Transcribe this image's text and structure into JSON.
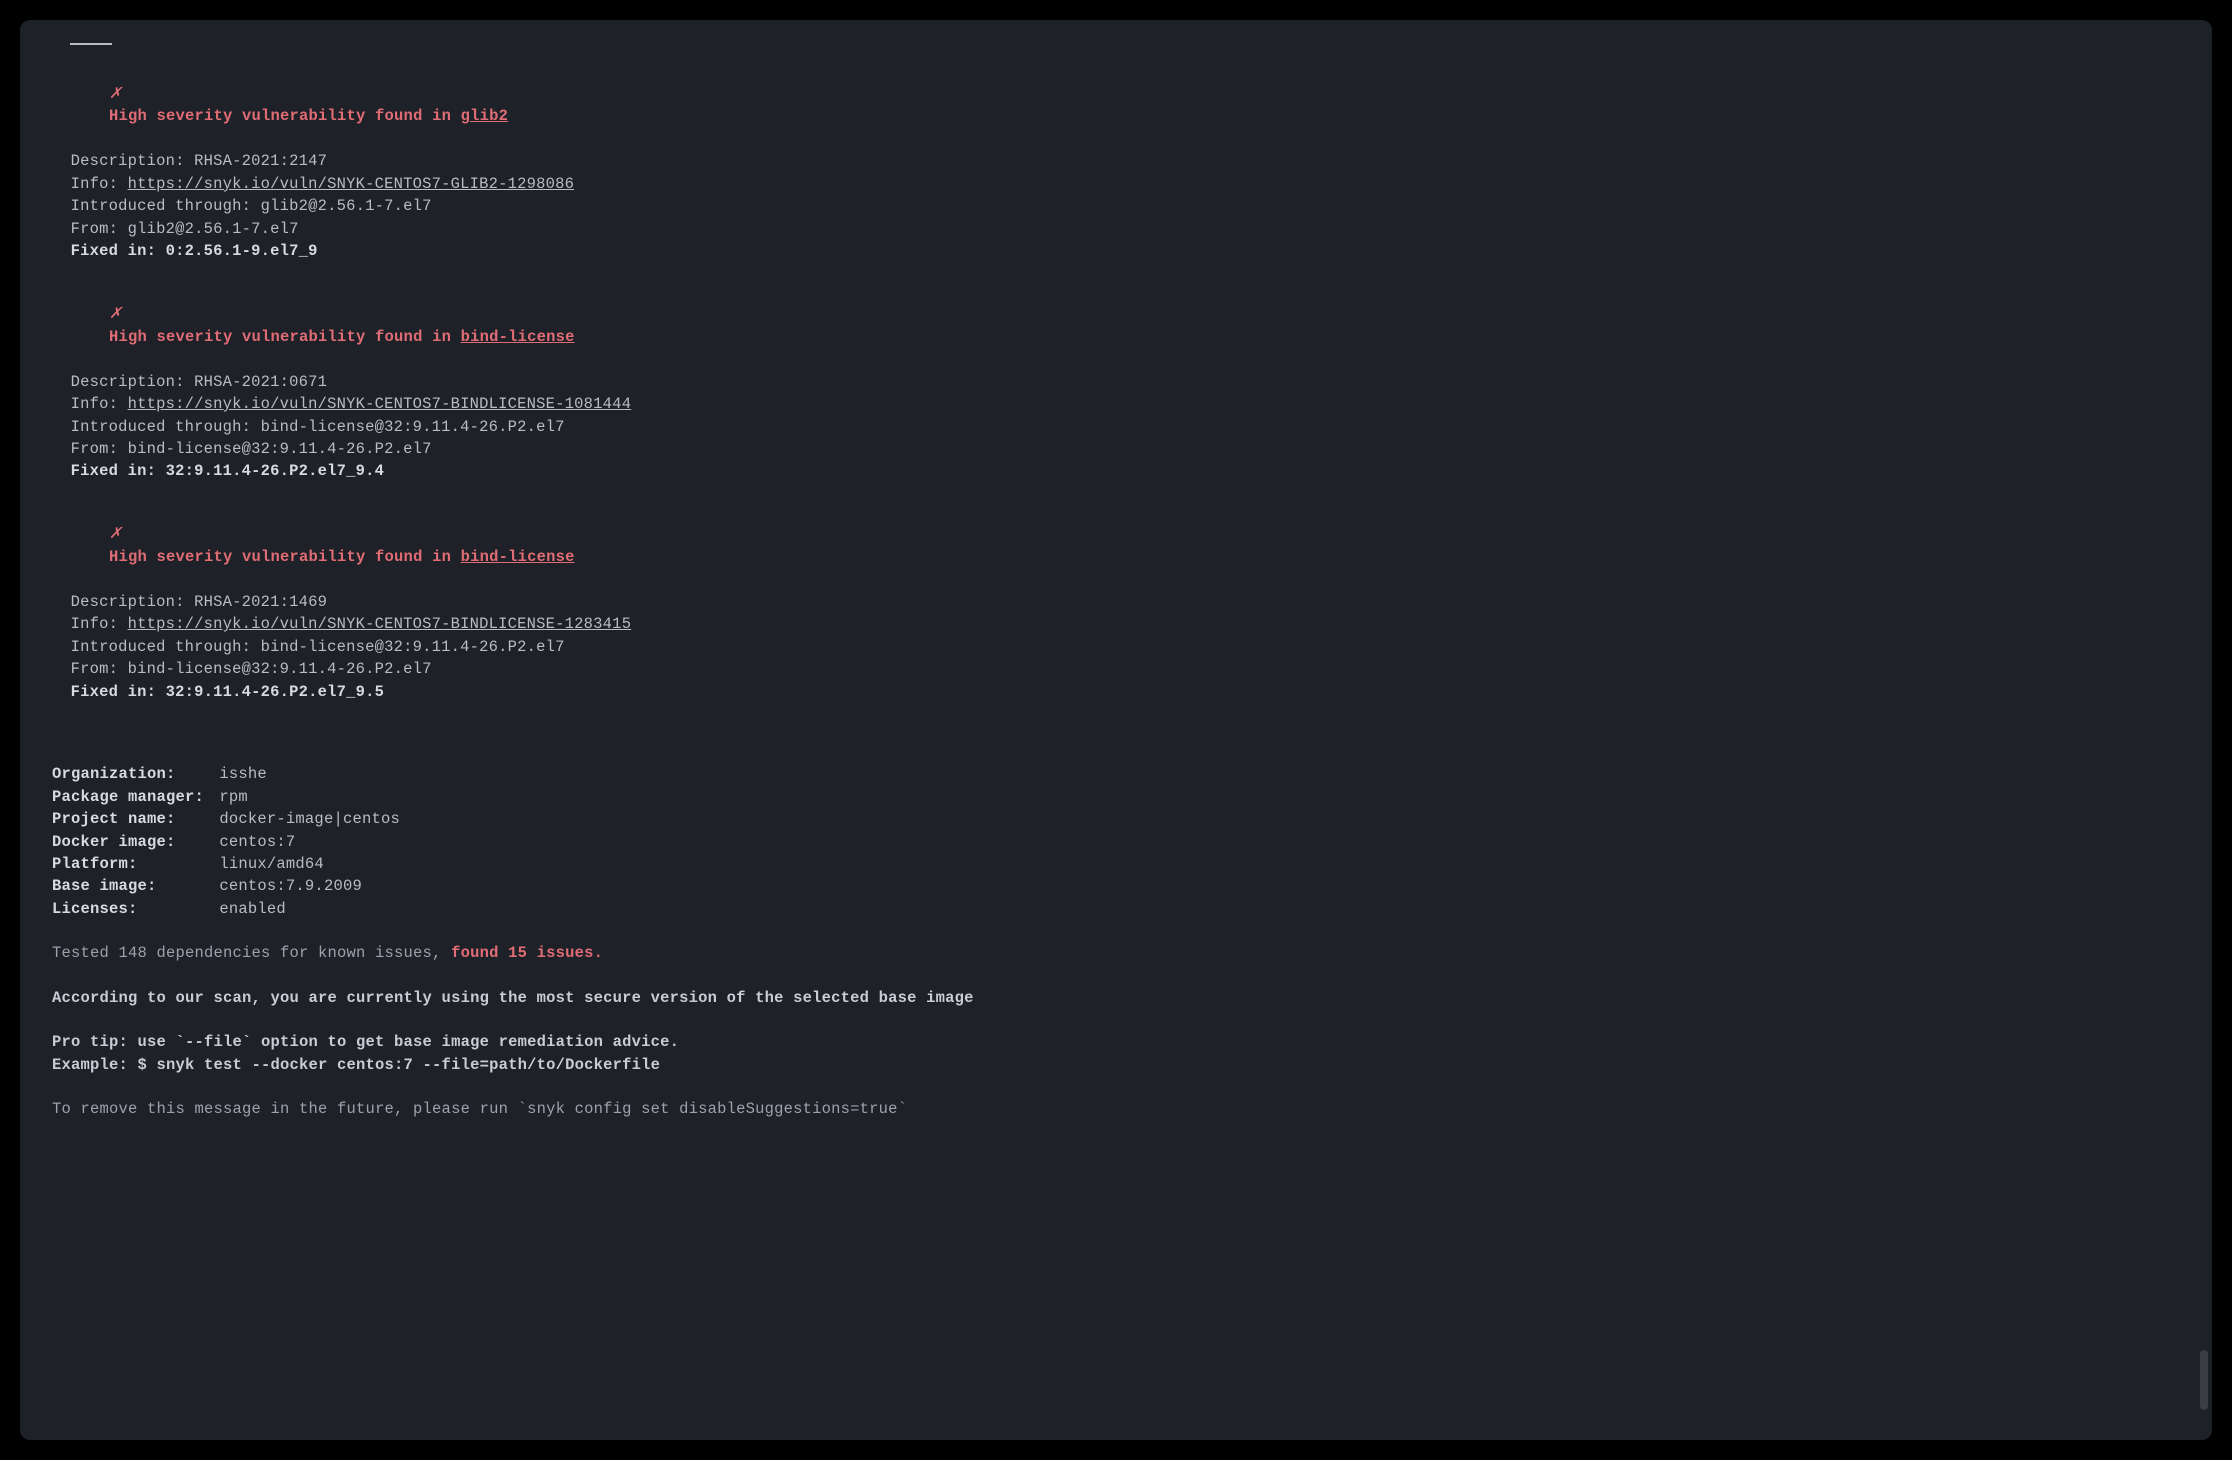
{
  "vulns": [
    {
      "severity_prefix": "High severity vulnerability found in ",
      "pkg": "glib2",
      "description": "RHSA-2021:2147",
      "info_url": "https://snyk.io/vuln/SNYK-CENTOS7-GLIB2-1298086",
      "introduced": "glib2@2.56.1-7.el7",
      "from": "glib2@2.56.1-7.el7",
      "fixed": "0:2.56.1-9.el7_9"
    },
    {
      "severity_prefix": "High severity vulnerability found in ",
      "pkg": "bind-license",
      "description": "RHSA-2021:0671",
      "info_url": "https://snyk.io/vuln/SNYK-CENTOS7-BINDLICENSE-1081444",
      "introduced": "bind-license@32:9.11.4-26.P2.el7",
      "from": "bind-license@32:9.11.4-26.P2.el7",
      "fixed": "32:9.11.4-26.P2.el7_9.4"
    },
    {
      "severity_prefix": "High severity vulnerability found in ",
      "pkg": "bind-license",
      "description": "RHSA-2021:1469",
      "info_url": "https://snyk.io/vuln/SNYK-CENTOS7-BINDLICENSE-1283415",
      "introduced": "bind-license@32:9.11.4-26.P2.el7",
      "from": "bind-license@32:9.11.4-26.P2.el7",
      "fixed": "32:9.11.4-26.P2.el7_9.5"
    }
  ],
  "labels": {
    "description": "Description: ",
    "info": "Info: ",
    "introduced": "Introduced through: ",
    "from": "From: ",
    "fixed": "Fixed in: ",
    "x": "✗"
  },
  "meta": {
    "org_label": "Organization:",
    "org_val": "isshe",
    "pm_label": "Package manager:",
    "pm_val": "rpm",
    "proj_label": "Project name:",
    "proj_val": "docker-image|centos",
    "img_label": "Docker image:",
    "img_val": "centos:7",
    "plat_label": "Platform:",
    "plat_val": "linux/amd64",
    "base_label": "Base image:",
    "base_val": "centos:7.9.2009",
    "lic_label": "Licenses:",
    "lic_val": "enabled"
  },
  "summary": {
    "tested_prefix": "Tested 148 dependencies for known issues, ",
    "found": "found 15 issues.",
    "scan_msg": "According to our scan, you are currently using the most secure version of the selected base image",
    "protip": "Pro tip: use `--file` option to get base image remediation advice.",
    "example": "Example: $ snyk test --docker centos:7 --file=path/to/Dockerfile",
    "remove": "To remove this message in the future, please run `snyk config set disableSuggestions=true`"
  }
}
